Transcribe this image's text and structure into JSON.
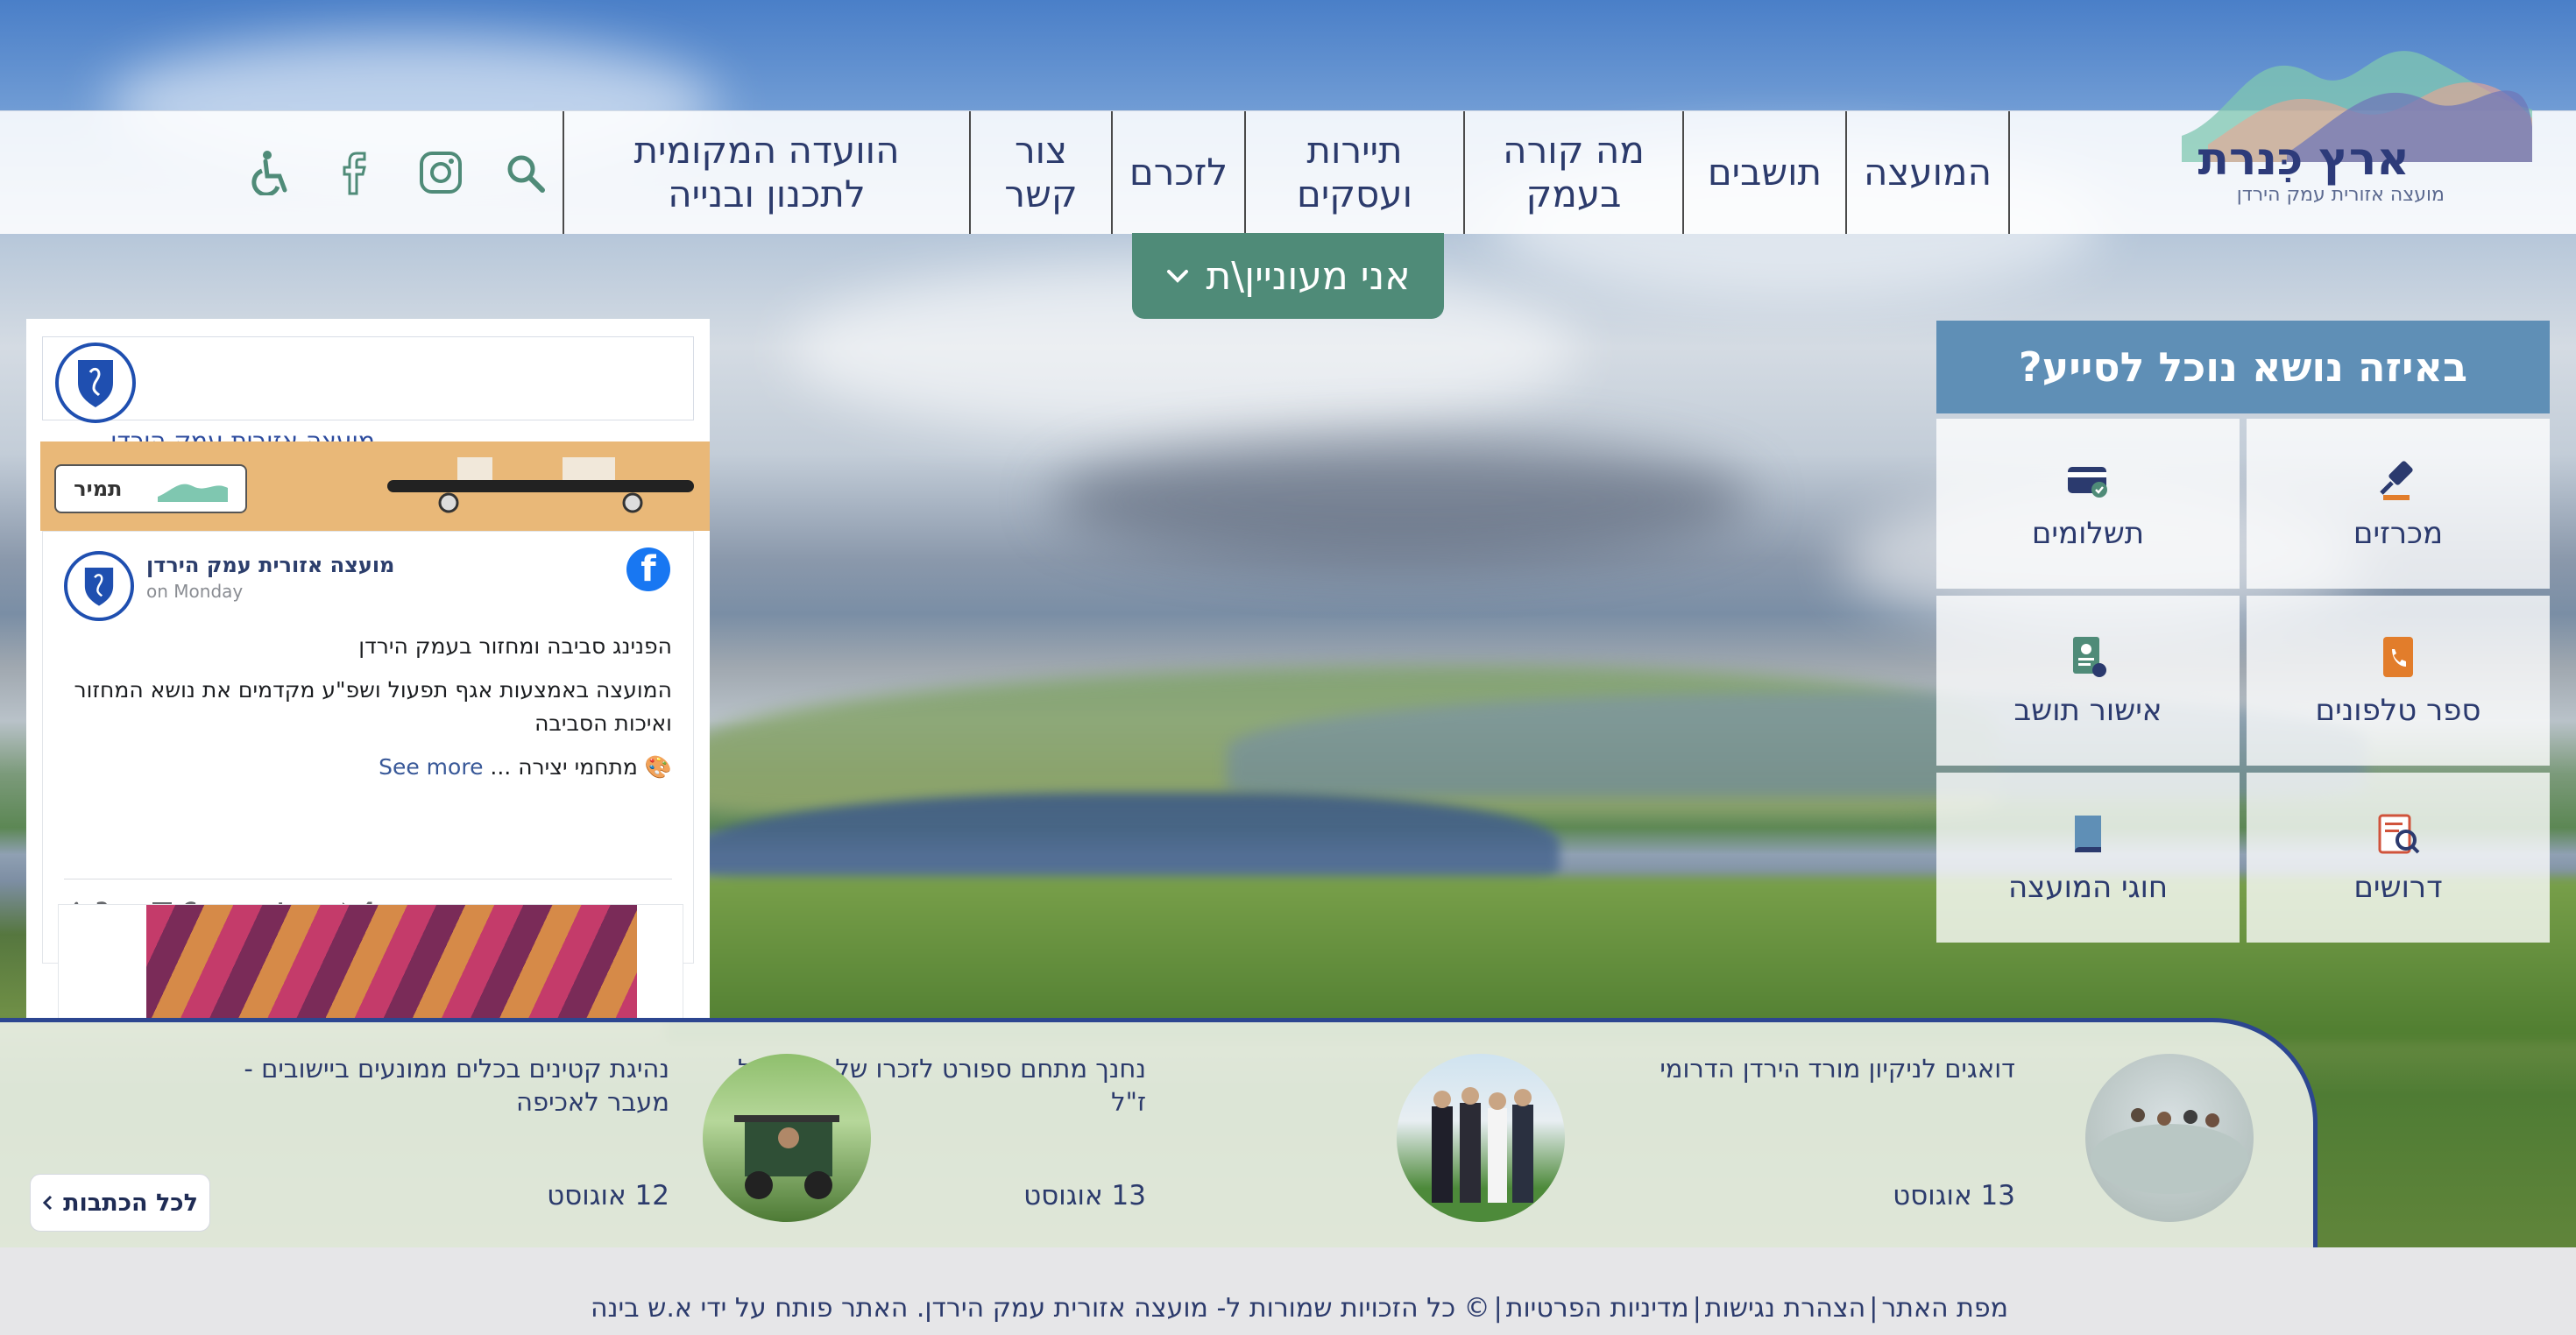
{
  "site": {
    "logo_text": "ארץ כִּנרת",
    "logo_sub": "מועצה אזורית עמק הירדן"
  },
  "nav": {
    "items": [
      {
        "label": "המועצה"
      },
      {
        "label": "תושבים"
      },
      {
        "label": "מה קורה\nבעמק"
      },
      {
        "label": "תיירות\nועסקים"
      },
      {
        "label": "לזכרם"
      },
      {
        "label": "צור\nקשר"
      },
      {
        "label": "הוועדה המקומית\nלתכנון ובנייה"
      }
    ],
    "icons": [
      "search-icon",
      "instagram-icon",
      "facebook-icon",
      "accessibility-icon"
    ]
  },
  "interest": {
    "label": "אני מעוניין\\ת"
  },
  "help": {
    "title": "באיזה נושא נוכל לסייע?",
    "cells": [
      {
        "label": "תשלומים",
        "icon": "payment-card-icon"
      },
      {
        "label": "מכרזים",
        "icon": "gavel-icon"
      },
      {
        "label": "אישור תושב",
        "icon": "resident-doc-icon"
      },
      {
        "label": "ספר טלפונים",
        "icon": "phonebook-icon"
      },
      {
        "label": "חוגי המועצה",
        "icon": "book-icon"
      },
      {
        "label": "דרושים",
        "icon": "jobs-icon"
      }
    ]
  },
  "facebook": {
    "header_cut_text": "מועצה אזורית עמק הירדן",
    "banner_logo_text": "תמיר",
    "post": {
      "author": "מועצה אזורית עמק הירדן",
      "time": "on Monday",
      "line1": "הפנינג סביבה ומחזור בעמק הירדן",
      "line2": "המועצה באמצעות אגף תפעול ושפ\"ע מקדמים את נושא המחזור ואיכות הסביבה",
      "line3": "🎨 מתחמי יצירה ...",
      "see_more": "See more",
      "likes": "2",
      "comment_label": "Comment",
      "shares": "4"
    }
  },
  "news": {
    "items": [
      {
        "title": "דואגים לניקיון מורד הירדן הדרומי",
        "date": "13 אוגוסט"
      },
      {
        "title": "נחנך מתחם ספורט לזכרו של גדי כוטל ז\"ל",
        "date": "13 אוגוסט"
      },
      {
        "title": "נהיגת קטינים בכלים ממונעים ביישובים - מעבר לאכיפה",
        "date": "12 אוגוסט"
      }
    ],
    "all_posts_label": "לכל הכתבות"
  },
  "footer": {
    "sitemap": "מפת האתר",
    "accessibility": "הצהרת נגישות",
    "privacy": "מדיניות הפרטיות",
    "rights": "© כל הזכויות שמורות ל- מועצה אזורית עמק הירדן. האתר פותח על ידי",
    "developer": "א.ש בינה"
  },
  "colors": {
    "brand_dark": "#2c3b6c",
    "accent_green": "#4f8b78",
    "help_title_bg": "#5f8fb6",
    "news_border": "#2c4690",
    "facebook_blue": "#1877f2"
  }
}
